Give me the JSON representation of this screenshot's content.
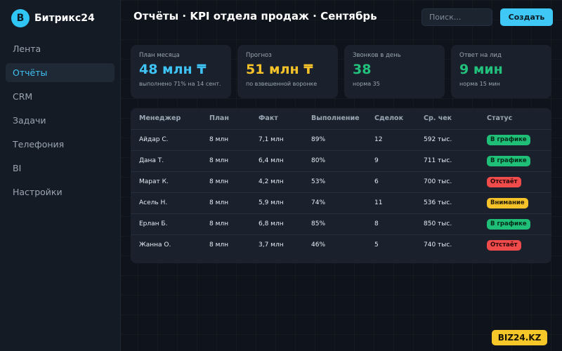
{
  "app": {
    "logo_letter": "B",
    "name": "Битрикс24"
  },
  "sidebar": {
    "items": [
      {
        "label": "Лента",
        "active": false
      },
      {
        "label": "Отчёты",
        "active": true
      },
      {
        "label": "CRM",
        "active": false
      },
      {
        "label": "Задачи",
        "active": false
      },
      {
        "label": "Телефония",
        "active": false
      },
      {
        "label": "BI",
        "active": false
      },
      {
        "label": "Настройки",
        "active": false
      }
    ]
  },
  "header": {
    "title": "Отчёты · KPI отдела продаж · Сентябрь",
    "search_placeholder": "Поиск...",
    "create_label": "Создать"
  },
  "kpis": [
    {
      "label": "План месяца",
      "value": "48 млн ₸",
      "note": "выполнено 71% на 14 сент.",
      "color": "#3fc3f5"
    },
    {
      "label": "Прогноз",
      "value": "51 млн ₸",
      "note": "по взвешенной воронке",
      "color": "#f5c329"
    },
    {
      "label": "Звонков в день",
      "value": "38",
      "note": "норма 35",
      "color": "#22c17c"
    },
    {
      "label": "Ответ на лид",
      "value": "9 мин",
      "note": "норма 15 мин",
      "color": "#22c17c"
    }
  ],
  "table": {
    "columns": [
      "Менеджер",
      "План",
      "Факт",
      "Выполнение",
      "Сделок",
      "Ср. чек",
      "Статус"
    ],
    "rows": [
      {
        "manager": "Айдар С.",
        "plan": "8 млн",
        "fact": "7,1 млн",
        "completion": "89%",
        "deals": "12",
        "avg_check": "592 тыс.",
        "status": "В графике",
        "status_type": "ok"
      },
      {
        "manager": "Дана Т.",
        "plan": "8 млн",
        "fact": "6,4 млн",
        "completion": "80%",
        "deals": "9",
        "avg_check": "711 тыс.",
        "status": "В графике",
        "status_type": "ok"
      },
      {
        "manager": "Марат К.",
        "plan": "8 млн",
        "fact": "4,2 млн",
        "completion": "53%",
        "deals": "6",
        "avg_check": "700 тыс.",
        "status": "Отстаёт",
        "status_type": "bad"
      },
      {
        "manager": "Асель Н.",
        "plan": "8 млн",
        "fact": "5,9 млн",
        "completion": "74%",
        "deals": "11",
        "avg_check": "536 тыс.",
        "status": "Внимание",
        "status_type": "warn"
      },
      {
        "manager": "Ерлан Б.",
        "plan": "8 млн",
        "fact": "6,8 млн",
        "completion": "85%",
        "deals": "8",
        "avg_check": "850 тыс.",
        "status": "В графике",
        "status_type": "ok"
      },
      {
        "manager": "Жанна О.",
        "plan": "8 млн",
        "fact": "3,7 млн",
        "completion": "46%",
        "deals": "5",
        "avg_check": "740 тыс.",
        "status": "Отстаёт",
        "status_type": "bad"
      }
    ]
  },
  "watermark": "BIZ24.KZ",
  "colors": {
    "accent": "#3fc8f6",
    "ok": "#1fbf78",
    "bad": "#ef4b4b",
    "warn": "#f5c329"
  }
}
